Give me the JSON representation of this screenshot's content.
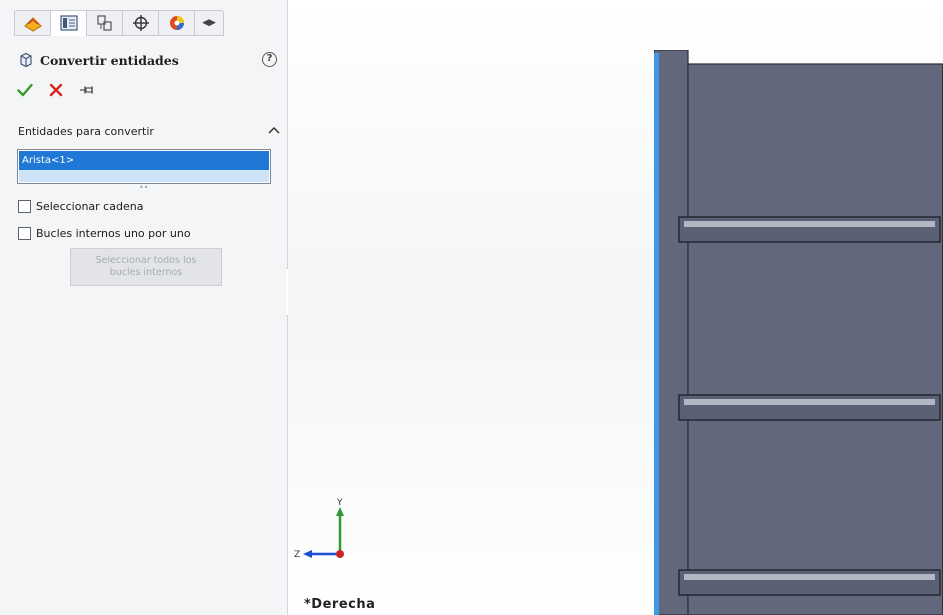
{
  "property_manager": {
    "tabs": [
      {
        "icon": "feature-manager-icon"
      },
      {
        "icon": "property-manager-icon",
        "active": true
      },
      {
        "icon": "configuration-manager-icon"
      },
      {
        "icon": "dimxpert-manager-icon"
      },
      {
        "icon": "display-manager-icon"
      },
      {
        "icon": "tab-scroll-arrows-icon"
      }
    ],
    "title": "Convertir entidades",
    "actions": {
      "ok": "ok-checkmark-icon",
      "cancel": "cancel-x-icon",
      "pin": "pushpin-icon"
    },
    "group": {
      "title": "Entidades para convertir",
      "selection_items": [
        "Arista<1>"
      ]
    },
    "options": [
      {
        "label": "Seleccionar cadena",
        "checked": false
      },
      {
        "label": "Bucles internos uno por uno",
        "checked": false
      }
    ],
    "select_all_loops_button": "Seleccionar todos los bucles internos"
  },
  "viewport": {
    "view_name": "*Derecha",
    "triad": {
      "y_label": "Y",
      "z_label": "Z"
    }
  },
  "colors": {
    "accent_blue": "#1f78d6",
    "part_face": "#62677c",
    "ok_green": "#3a9a2a",
    "cancel_red": "#d5261f"
  }
}
